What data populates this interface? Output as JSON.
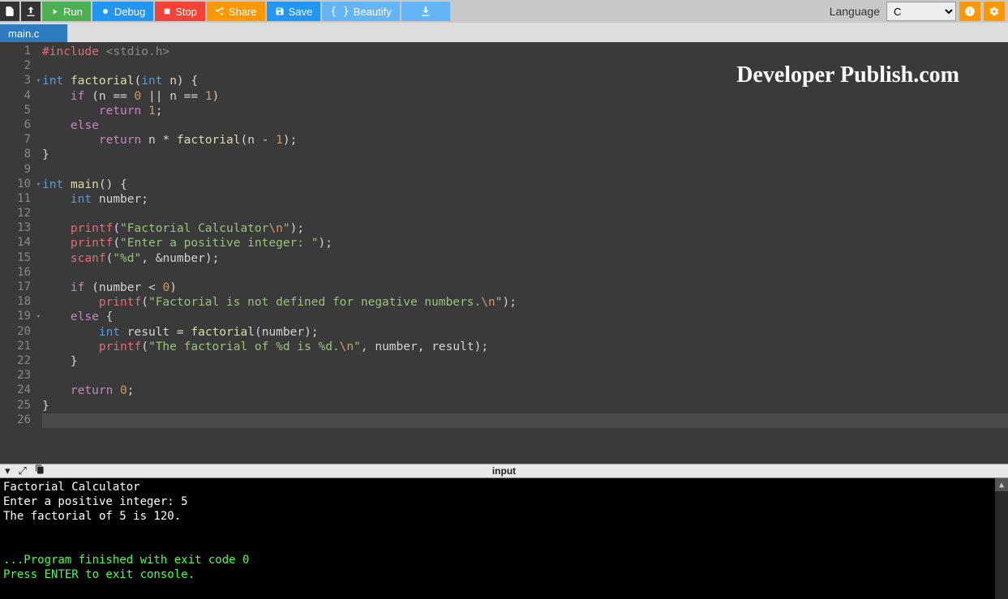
{
  "toolbar": {
    "run_label": "Run",
    "debug_label": "Debug",
    "stop_label": "Stop",
    "share_label": "Share",
    "save_label": "Save",
    "beautify_label": "Beautify",
    "language_label": "Language",
    "language_selected": "C"
  },
  "tab": {
    "filename": "main.c"
  },
  "watermark": "Developer Publish.com",
  "code": {
    "lines": [
      {
        "n": 1,
        "fold": false,
        "tokens": [
          [
            "pre",
            "#include"
          ],
          [
            "plain",
            " "
          ],
          [
            "inc",
            "<stdio.h>"
          ]
        ]
      },
      {
        "n": 2,
        "fold": false,
        "tokens": []
      },
      {
        "n": 3,
        "fold": true,
        "tokens": [
          [
            "type",
            "int"
          ],
          [
            "plain",
            " "
          ],
          [
            "fn",
            "factorial"
          ],
          [
            "paren",
            "("
          ],
          [
            "type",
            "int"
          ],
          [
            "plain",
            " "
          ],
          [
            "id",
            "n"
          ],
          [
            "paren",
            ")"
          ],
          [
            "plain",
            " "
          ],
          [
            "paren",
            "{"
          ]
        ]
      },
      {
        "n": 4,
        "fold": false,
        "tokens": [
          [
            "plain",
            "    "
          ],
          [
            "kw",
            "if"
          ],
          [
            "plain",
            " "
          ],
          [
            "paren",
            "("
          ],
          [
            "id",
            "n"
          ],
          [
            "plain",
            " "
          ],
          [
            "op",
            "=="
          ],
          [
            "plain",
            " "
          ],
          [
            "num",
            "0"
          ],
          [
            "plain",
            " "
          ],
          [
            "op",
            "||"
          ],
          [
            "plain",
            " "
          ],
          [
            "id",
            "n"
          ],
          [
            "plain",
            " "
          ],
          [
            "op",
            "=="
          ],
          [
            "plain",
            " "
          ],
          [
            "num",
            "1"
          ],
          [
            "paren",
            ")"
          ]
        ]
      },
      {
        "n": 5,
        "fold": false,
        "tokens": [
          [
            "plain",
            "        "
          ],
          [
            "kw",
            "return"
          ],
          [
            "plain",
            " "
          ],
          [
            "num",
            "1"
          ],
          [
            "op",
            ";"
          ]
        ]
      },
      {
        "n": 6,
        "fold": false,
        "tokens": [
          [
            "plain",
            "    "
          ],
          [
            "kw",
            "else"
          ]
        ]
      },
      {
        "n": 7,
        "fold": false,
        "tokens": [
          [
            "plain",
            "        "
          ],
          [
            "kw",
            "return"
          ],
          [
            "plain",
            " "
          ],
          [
            "id",
            "n"
          ],
          [
            "plain",
            " "
          ],
          [
            "op",
            "*"
          ],
          [
            "plain",
            " "
          ],
          [
            "fn",
            "factorial"
          ],
          [
            "paren",
            "("
          ],
          [
            "id",
            "n"
          ],
          [
            "plain",
            " "
          ],
          [
            "op",
            "-"
          ],
          [
            "plain",
            " "
          ],
          [
            "num",
            "1"
          ],
          [
            "paren",
            ")"
          ],
          [
            "op",
            ";"
          ]
        ]
      },
      {
        "n": 8,
        "fold": false,
        "tokens": [
          [
            "paren",
            "}"
          ]
        ]
      },
      {
        "n": 9,
        "fold": false,
        "tokens": []
      },
      {
        "n": 10,
        "fold": true,
        "tokens": [
          [
            "type",
            "int"
          ],
          [
            "plain",
            " "
          ],
          [
            "fn",
            "main"
          ],
          [
            "paren",
            "()"
          ],
          [
            "plain",
            " "
          ],
          [
            "paren",
            "{"
          ]
        ]
      },
      {
        "n": 11,
        "fold": false,
        "tokens": [
          [
            "plain",
            "    "
          ],
          [
            "type",
            "int"
          ],
          [
            "plain",
            " "
          ],
          [
            "id",
            "number"
          ],
          [
            "op",
            ";"
          ]
        ]
      },
      {
        "n": 12,
        "fold": false,
        "tokens": []
      },
      {
        "n": 13,
        "fold": false,
        "tokens": [
          [
            "plain",
            "    "
          ],
          [
            "call",
            "printf"
          ],
          [
            "paren",
            "("
          ],
          [
            "str",
            "\"Factorial Calculator"
          ],
          [
            "esc",
            "\\n"
          ],
          [
            "str",
            "\""
          ],
          [
            "paren",
            ")"
          ],
          [
            "op",
            ";"
          ]
        ]
      },
      {
        "n": 14,
        "fold": false,
        "tokens": [
          [
            "plain",
            "    "
          ],
          [
            "call",
            "printf"
          ],
          [
            "paren",
            "("
          ],
          [
            "str",
            "\"Enter a positive integer: \""
          ],
          [
            "paren",
            ")"
          ],
          [
            "op",
            ";"
          ]
        ]
      },
      {
        "n": 15,
        "fold": false,
        "tokens": [
          [
            "plain",
            "    "
          ],
          [
            "call",
            "scanf"
          ],
          [
            "paren",
            "("
          ],
          [
            "str",
            "\"%d\""
          ],
          [
            "op",
            ","
          ],
          [
            "plain",
            " "
          ],
          [
            "op",
            "&"
          ],
          [
            "id",
            "number"
          ],
          [
            "paren",
            ")"
          ],
          [
            "op",
            ";"
          ]
        ]
      },
      {
        "n": 16,
        "fold": false,
        "tokens": []
      },
      {
        "n": 17,
        "fold": false,
        "tokens": [
          [
            "plain",
            "    "
          ],
          [
            "kw",
            "if"
          ],
          [
            "plain",
            " "
          ],
          [
            "paren",
            "("
          ],
          [
            "id",
            "number"
          ],
          [
            "plain",
            " "
          ],
          [
            "op",
            "<"
          ],
          [
            "plain",
            " "
          ],
          [
            "num",
            "0"
          ],
          [
            "paren",
            ")"
          ]
        ]
      },
      {
        "n": 18,
        "fold": false,
        "tokens": [
          [
            "plain",
            "        "
          ],
          [
            "call",
            "printf"
          ],
          [
            "paren",
            "("
          ],
          [
            "str",
            "\"Factorial is not defined for negative numbers."
          ],
          [
            "esc",
            "\\n"
          ],
          [
            "str",
            "\""
          ],
          [
            "paren",
            ")"
          ],
          [
            "op",
            ";"
          ]
        ]
      },
      {
        "n": 19,
        "fold": true,
        "tokens": [
          [
            "plain",
            "    "
          ],
          [
            "kw",
            "else"
          ],
          [
            "plain",
            " "
          ],
          [
            "paren",
            "{"
          ]
        ]
      },
      {
        "n": 20,
        "fold": false,
        "tokens": [
          [
            "plain",
            "        "
          ],
          [
            "type",
            "int"
          ],
          [
            "plain",
            " "
          ],
          [
            "id",
            "result"
          ],
          [
            "plain",
            " "
          ],
          [
            "op",
            "="
          ],
          [
            "plain",
            " "
          ],
          [
            "fn",
            "factorial"
          ],
          [
            "paren",
            "("
          ],
          [
            "id",
            "number"
          ],
          [
            "paren",
            ")"
          ],
          [
            "op",
            ";"
          ]
        ]
      },
      {
        "n": 21,
        "fold": false,
        "tokens": [
          [
            "plain",
            "        "
          ],
          [
            "call",
            "printf"
          ],
          [
            "paren",
            "("
          ],
          [
            "str",
            "\"The factorial of %d is %d."
          ],
          [
            "esc",
            "\\n"
          ],
          [
            "str",
            "\""
          ],
          [
            "op",
            ","
          ],
          [
            "plain",
            " "
          ],
          [
            "id",
            "number"
          ],
          [
            "op",
            ","
          ],
          [
            "plain",
            " "
          ],
          [
            "id",
            "result"
          ],
          [
            "paren",
            ")"
          ],
          [
            "op",
            ";"
          ]
        ]
      },
      {
        "n": 22,
        "fold": false,
        "tokens": [
          [
            "plain",
            "    "
          ],
          [
            "paren",
            "}"
          ]
        ]
      },
      {
        "n": 23,
        "fold": false,
        "tokens": []
      },
      {
        "n": 24,
        "fold": false,
        "tokens": [
          [
            "plain",
            "    "
          ],
          [
            "kw",
            "return"
          ],
          [
            "plain",
            " "
          ],
          [
            "num",
            "0"
          ],
          [
            "op",
            ";"
          ]
        ]
      },
      {
        "n": 25,
        "fold": false,
        "tokens": [
          [
            "paren",
            "}"
          ]
        ]
      },
      {
        "n": 26,
        "fold": false,
        "tokens": [],
        "active": true
      }
    ]
  },
  "console": {
    "title": "input",
    "output": [
      {
        "text": "Factorial Calculator",
        "cls": ""
      },
      {
        "text": "Enter a positive integer: 5",
        "cls": ""
      },
      {
        "text": "The factorial of 5 is 120.",
        "cls": ""
      },
      {
        "text": "",
        "cls": ""
      },
      {
        "text": "",
        "cls": ""
      },
      {
        "text": "...Program finished with exit code 0",
        "cls": "green"
      },
      {
        "text": "Press ENTER to exit console.",
        "cls": "green"
      }
    ]
  }
}
